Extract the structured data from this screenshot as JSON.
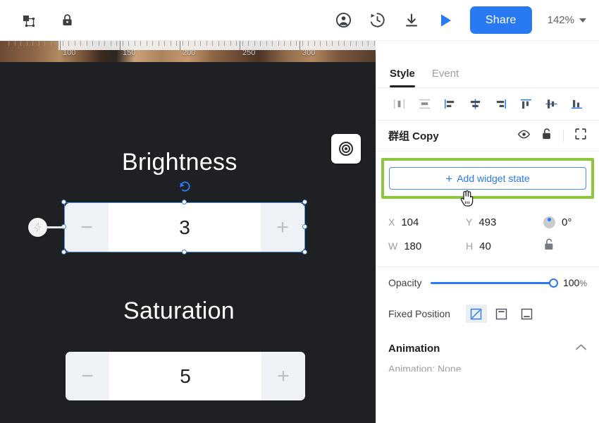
{
  "toolbar": {
    "left_icons": [
      {
        "name": "group-frame-icon"
      },
      {
        "name": "lock-icon"
      }
    ],
    "right_icons": [
      {
        "name": "account-icon"
      },
      {
        "name": "history-icon"
      },
      {
        "name": "download-icon"
      },
      {
        "name": "play-icon"
      }
    ],
    "share_label": "Share",
    "zoom_level": "142%"
  },
  "ruler": {
    "labels": [
      "100",
      "150",
      "200",
      "250",
      "300"
    ],
    "positions": [
      95,
      180,
      265,
      350,
      435
    ]
  },
  "canvas": {
    "preview_icon": "target-icon",
    "widgets": [
      {
        "label": "Brightness",
        "value": "3",
        "minus": "−",
        "plus": "+",
        "selected": true,
        "rotate_icon": "rotate-icon",
        "trigger_icon": "lightning-bolt-icon"
      },
      {
        "label": "Saturation",
        "value": "5",
        "minus": "−",
        "plus": "+",
        "selected": false
      }
    ]
  },
  "panel": {
    "tabs": [
      {
        "label": "Style",
        "active": true
      },
      {
        "label": "Event",
        "active": false
      }
    ],
    "align_buttons": [
      {
        "name": "distribute-horizontal-icon"
      },
      {
        "name": "distribute-vertical-icon"
      },
      {
        "name": "align-left-icon"
      },
      {
        "name": "align-center-horizontal-icon"
      },
      {
        "name": "align-right-icon"
      },
      {
        "name": "align-top-icon"
      },
      {
        "name": "align-middle-vertical-icon"
      },
      {
        "name": "align-bottom-icon"
      }
    ],
    "layer": {
      "name": "群组 Copy",
      "icons": [
        "eye-icon",
        "unlock-icon",
        "fit-icon"
      ]
    },
    "add_state_label": "Add widget state",
    "add_state_plus": "+",
    "highlight_color": "#8dc63f",
    "accent_color": "#2979f2",
    "properties": {
      "x_label": "X",
      "x_value": "104",
      "y_label": "Y",
      "y_value": "493",
      "rotation_value": "0°",
      "w_label": "W",
      "w_value": "180",
      "h_label": "H",
      "h_value": "40",
      "aspect_lock_icon": "unlock-icon"
    },
    "opacity": {
      "label": "Opacity",
      "value": "100",
      "unit": "%",
      "percent": 100
    },
    "fixed_position": {
      "label": "Fixed Position",
      "options": [
        {
          "name": "fixed-none-icon",
          "active": true
        },
        {
          "name": "fixed-top-icon",
          "active": false
        },
        {
          "name": "fixed-bottom-icon",
          "active": false
        }
      ]
    },
    "animation": {
      "title": "Animation",
      "chevron": "chevron-up-icon",
      "sub_label": "Animation: None"
    }
  }
}
